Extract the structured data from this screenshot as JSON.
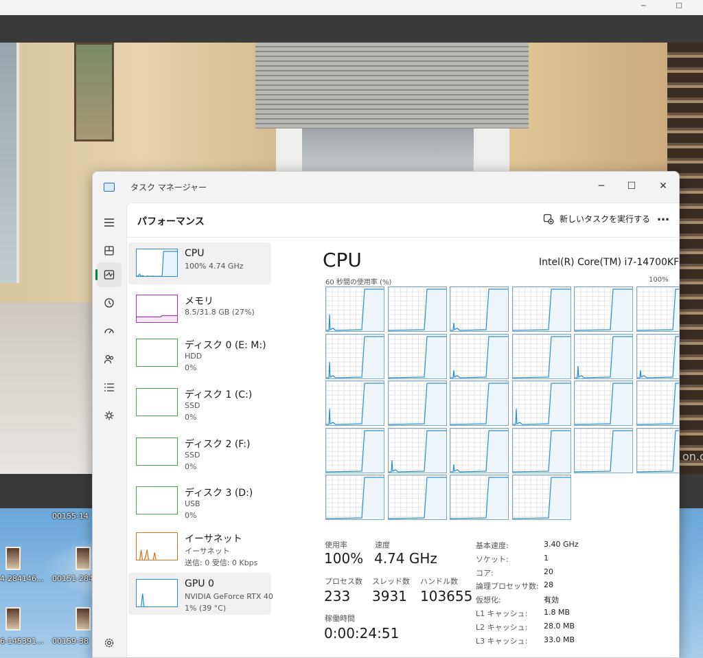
{
  "window": {
    "title": "タスク マネージャー",
    "page_title": "パフォーマンス",
    "run_task_label": "新しいタスクを実行する",
    "more_label": "…"
  },
  "background": {
    "desktop_labels": [
      "00155-14",
      "4-284146...",
      "00151-284",
      "6-145391...",
      "00159-38",
      "on.c"
    ]
  },
  "nav": [
    {
      "name": "menu-icon"
    },
    {
      "name": "processes-icon"
    },
    {
      "name": "performance-icon",
      "active": true
    },
    {
      "name": "app-history-icon"
    },
    {
      "name": "startup-apps-icon"
    },
    {
      "name": "users-icon"
    },
    {
      "name": "details-icon"
    },
    {
      "name": "services-icon"
    },
    {
      "name": "settings-icon"
    }
  ],
  "sidebar": [
    {
      "name": "CPU",
      "sub1": "100%  4.74 GHz",
      "sub2": "",
      "sub3": "",
      "color": "#2a8ec9",
      "fill": "#e8f2fa",
      "points": [
        0.02,
        0.03,
        0.1,
        0.02,
        0.04,
        0.02,
        0.01,
        0.03,
        0.02,
        0.02,
        0.02,
        0.03,
        0.02,
        0.02,
        0.02,
        0.02,
        0.02,
        0.02,
        0.95,
        0.95,
        0.95,
        0.95,
        0.95,
        0.95,
        0.95,
        0.95,
        0.95,
        0.95
      ],
      "selected": true
    },
    {
      "name": "メモリ",
      "sub1": "8.5/31.8 GB (27%)",
      "sub2": "",
      "sub3": "",
      "color": "#9a3aa8",
      "fill": "#f4e8f6",
      "points": [
        0.22,
        0.22,
        0.22,
        0.22,
        0.22,
        0.22,
        0.22,
        0.22,
        0.22,
        0.22,
        0.22,
        0.22,
        0.22,
        0.22,
        0.22,
        0.22,
        0.22,
        0.27,
        0.27,
        0.27,
        0.27,
        0.27,
        0.27,
        0.27,
        0.27,
        0.27,
        0.27,
        0.27
      ],
      "selected": false
    },
    {
      "name": "ディスク 0 (E: M:)",
      "sub1": "HDD",
      "sub2": "0%",
      "sub3": "",
      "color": "#4aa34a",
      "fill": "#eaf6ea",
      "points": [],
      "selected": false
    },
    {
      "name": "ディスク 1 (C:)",
      "sub1": "SSD",
      "sub2": "0%",
      "sub3": "",
      "color": "#4aa34a",
      "fill": "#eaf6ea",
      "points": [],
      "selected": false
    },
    {
      "name": "ディスク 2 (F:)",
      "sub1": "SSD",
      "sub2": "0%",
      "sub3": "",
      "color": "#4aa34a",
      "fill": "#eaf6ea",
      "points": [],
      "selected": false
    },
    {
      "name": "ディスク 3 (D:)",
      "sub1": "USB",
      "sub2": "0%",
      "sub3": "",
      "color": "#4aa34a",
      "fill": "#eaf6ea",
      "points": [],
      "selected": false
    },
    {
      "name": "イーサネット",
      "sub1": "イーサネット",
      "sub2": "送信: 0 受信: 0 Kbps",
      "sub3": "",
      "color": "#c9782a",
      "fill": "#fbeee2",
      "points": [
        0,
        0,
        0,
        0.4,
        0,
        0,
        0.15,
        0.4,
        0,
        0,
        0,
        0,
        0.3,
        0,
        0,
        0,
        0,
        0,
        0,
        0,
        0,
        0,
        0,
        0,
        0,
        0,
        0,
        0
      ],
      "selected": false
    },
    {
      "name": "GPU 0",
      "sub1": "NVIDIA GeForce RTX 40",
      "sub2": "1% (39 °C)",
      "sub3": "",
      "color": "#2a8ec9",
      "fill": "#e8f2fa",
      "points": [
        0,
        0,
        0,
        0,
        0.5,
        0,
        0,
        0,
        0,
        0,
        0,
        0,
        0,
        0,
        0,
        0,
        0,
        0,
        0,
        0,
        0,
        0,
        0,
        0,
        0,
        0,
        0,
        0
      ],
      "selected": true
    }
  ],
  "cpu": {
    "title": "CPU",
    "model": "Intel(R) Core(TM) i7-14700KF",
    "graph_caption": "60 秒間の使用率 (%)",
    "graph_max": "100%",
    "core_count": 28,
    "core_line_color": "#2a8ec9",
    "core_fill_color": "#eef5fb",
    "spike_cores": [
      0,
      2,
      6,
      8,
      10,
      11,
      12,
      15,
      19,
      20
    ]
  },
  "stats": {
    "usage_label": "使用率",
    "usage_value": "100%",
    "speed_label": "速度",
    "speed_value": "4.74 GHz",
    "processes_label": "プロセス数",
    "processes_value": "233",
    "threads_label": "スレッド数",
    "threads_value": "3931",
    "handles_label": "ハンドル数",
    "handles_value": "103655",
    "uptime_label": "稼働時間",
    "uptime_value": "0:00:24:51"
  },
  "specs": [
    {
      "label": "基本速度:",
      "value": "3.40 GHz"
    },
    {
      "label": "ソケット:",
      "value": "1"
    },
    {
      "label": "コア:",
      "value": "20"
    },
    {
      "label": "論理プロセッサ数:",
      "value": "28"
    },
    {
      "label": "仮想化:",
      "value": "有効"
    },
    {
      "label": "L1 キャッシュ:",
      "value": "1.8 MB"
    },
    {
      "label": "L2 キャッシュ:",
      "value": "28.0 MB"
    },
    {
      "label": "L3 キャッシュ:",
      "value": "33.0 MB"
    }
  ]
}
